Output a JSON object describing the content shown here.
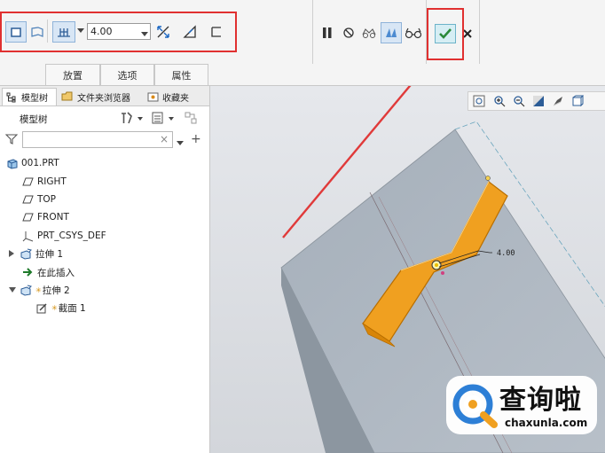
{
  "toolbar": {
    "depth_value": "4.00",
    "icons": [
      "solid-icon",
      "surface-icon",
      "blind-depth-icon",
      "dropdown-arrow-icon",
      "flip-direction-icon",
      "remove-material-icon",
      "thicken-icon",
      "pause-icon",
      "no-preview-icon",
      "glasses-preview-icon",
      "verify-preview-icon",
      "checkmark-icon",
      "cancel-icon"
    ]
  },
  "dashboard_tabs": [
    "放置",
    "选项",
    "属性"
  ],
  "panel": {
    "tabs": [
      "模型树",
      "文件夹浏览器",
      "收藏夹"
    ],
    "title": "模型树",
    "filter_placeholder": "",
    "tree": [
      {
        "label": "001.PRT",
        "icon": "part-icon"
      },
      {
        "label": "RIGHT",
        "icon": "datum-plane-icon"
      },
      {
        "label": "TOP",
        "icon": "datum-plane-icon"
      },
      {
        "label": "FRONT",
        "icon": "datum-plane-icon"
      },
      {
        "label": "PRT_CSYS_DEF",
        "icon": "csys-icon"
      },
      {
        "label": "拉伸 1",
        "icon": "extrude-icon"
      },
      {
        "label": "在此插入",
        "icon": "insert-here-arrow-icon"
      },
      {
        "label": "拉伸 2",
        "icon": "extrude-icon"
      },
      {
        "label": "截面 1",
        "icon": "sketch-icon"
      }
    ]
  },
  "viewport": {
    "dimension_label": "4.00",
    "toolbar_icons": [
      "refit-icon",
      "zoom-in-icon",
      "zoom-out-icon",
      "repaint-icon",
      "display-style-icon",
      "saved-views-icon"
    ]
  },
  "watermark": {
    "brand": "查询啦",
    "domain": "chaxunla.com"
  },
  "colors": {
    "highlight_box": "#e03030",
    "annotation_arrow": "#e03a3a",
    "checkmark": "#2a8a3a",
    "extrude_orange": "#f0a020",
    "part_gray": "#a8b2bd"
  }
}
